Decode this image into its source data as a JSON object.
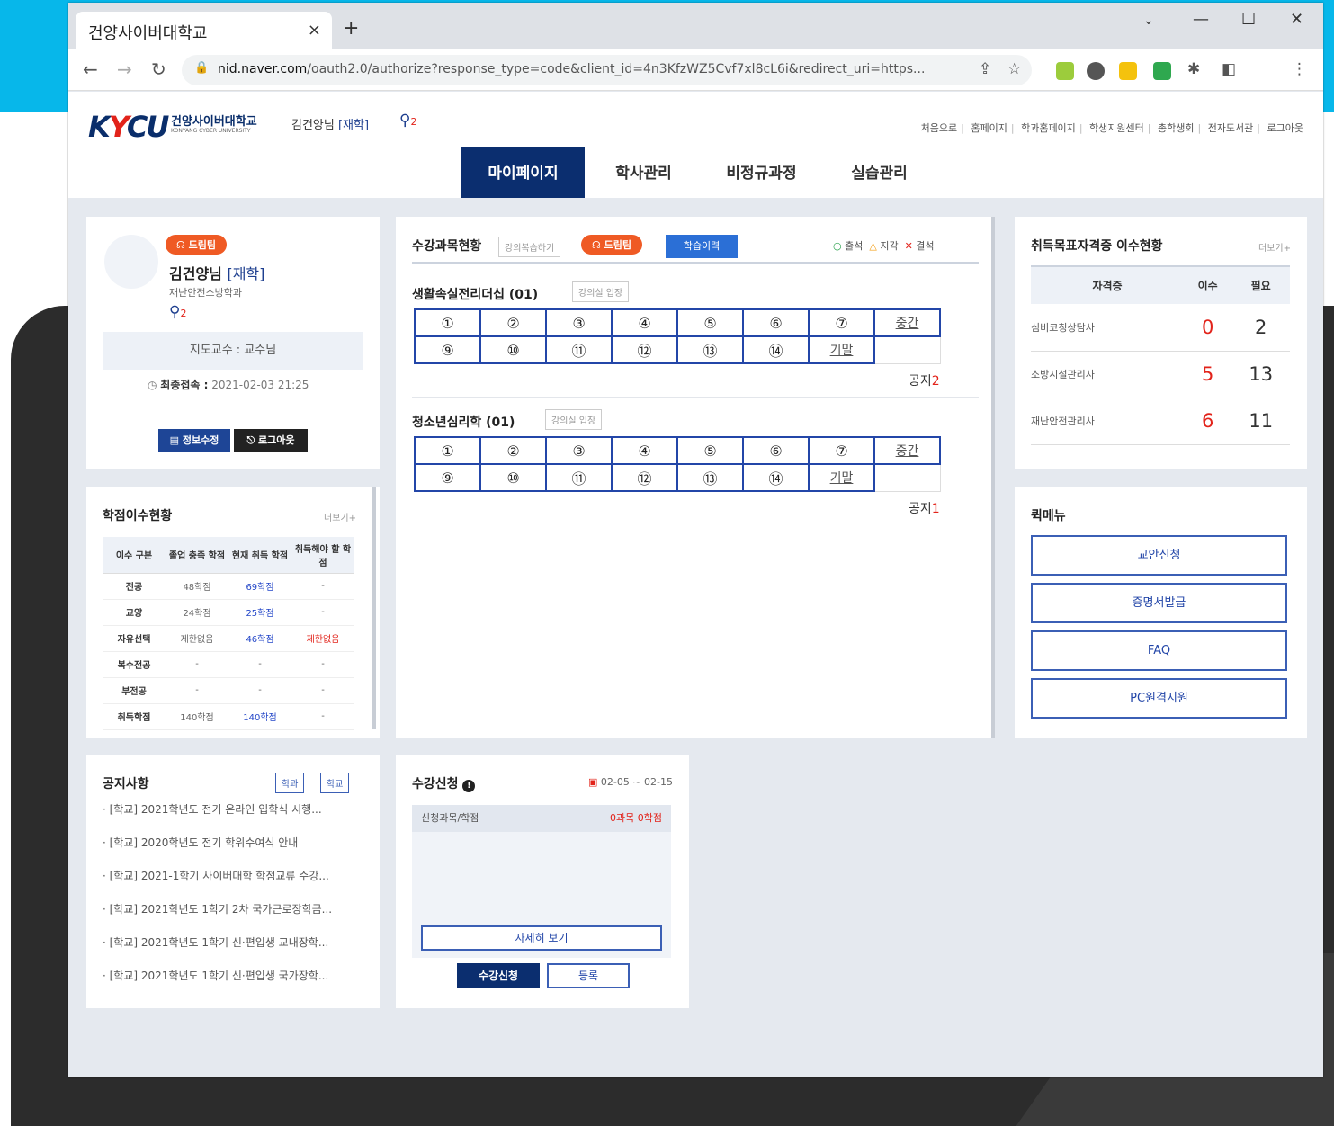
{
  "browser": {
    "tab_title": "건양사이버대학교",
    "tab_close": "×",
    "new_tab": "+",
    "url_host": "nid.naver.com",
    "url_path": "/oauth2.0/authorize?response_type=code&client_id=4n3KfzWZ5Cvf7xl8cL6i&redirect_uri=https..."
  },
  "header": {
    "logo_main": "KYCU",
    "logo_text": "건양사이버대학교",
    "logo_sub": "KONYANG CYBER UNIVERSITY",
    "user_name": "김건양님",
    "user_status": "[재학]",
    "pin_count": "2",
    "top_links": [
      "처음으로",
      "홈페이지",
      "학과홈페이지",
      "학생지원센터",
      "총학생회",
      "전자도서관",
      "로그아웃"
    ],
    "nav": [
      "마이페이지",
      "학사관리",
      "비정규과정",
      "실습관리"
    ]
  },
  "profile": {
    "badge": "드림팀",
    "name": "김건양님",
    "status": "[재학]",
    "dept": "재난안전소방학과",
    "pin_count": "2",
    "advisor": "지도교수 : 교수님",
    "last_login_label": "최종접속 :",
    "last_login": "2021-02-03 21:25",
    "btn_info": "정보수정",
    "btn_logout": "로그아웃"
  },
  "course_status": {
    "title": "수강과목현황",
    "review_btn": "강의복습하기",
    "badge": "드림팀",
    "history_btn": "학습이력",
    "legend_present": "출석",
    "legend_late": "지각",
    "legend_absent": "결석",
    "courses": [
      {
        "name": "생활속실전리더십 (01)",
        "enter": "강의실 입장",
        "row1": [
          "①",
          "②",
          "③",
          "④",
          "⑤",
          "⑥",
          "⑦",
          "중간"
        ],
        "row2": [
          "⑨",
          "⑩",
          "⑪",
          "⑫",
          "⑬",
          "⑭",
          "기말"
        ],
        "notice_label": "공지",
        "notice_count": "2"
      },
      {
        "name": "청소년심리학 (01)",
        "enter": "강의실 입장",
        "row1": [
          "①",
          "②",
          "③",
          "④",
          "⑤",
          "⑥",
          "⑦",
          "중간"
        ],
        "row2": [
          "⑨",
          "⑩",
          "⑪",
          "⑫",
          "⑬",
          "⑭",
          "기말"
        ],
        "notice_label": "공지",
        "notice_count": "1"
      }
    ]
  },
  "qualification": {
    "title": "취득목표자격증 이수현황",
    "more": "더보기+",
    "headers": [
      "자격증",
      "이수",
      "필요"
    ],
    "rows": [
      {
        "name": "심비코칭상담사",
        "done": "0",
        "need": "2"
      },
      {
        "name": "소방시설관리사",
        "done": "5",
        "need": "13"
      },
      {
        "name": "재난안전관리사",
        "done": "6",
        "need": "11"
      }
    ]
  },
  "credits": {
    "title": "학점이수현황",
    "more": "더보기+",
    "headers": [
      "이수 구분",
      "졸업 충족 학점",
      "현재 취득 학점",
      "취득해야 할 학점"
    ],
    "rows": [
      [
        "전공",
        "48학점",
        "69학점",
        "-"
      ],
      [
        "교양",
        "24학점",
        "25학점",
        "-"
      ],
      [
        "자유선택",
        "제한없음",
        "46학점",
        "제한없음"
      ],
      [
        "복수전공",
        "-",
        "-",
        "-"
      ],
      [
        "부전공",
        "-",
        "-",
        "-"
      ],
      [
        "취득학점",
        "140학점",
        "140학점",
        "-"
      ]
    ]
  },
  "quick_menu": {
    "title": "퀵메뉴",
    "items": [
      "교안신청",
      "증명서발급",
      "FAQ",
      "PC원격지원"
    ]
  },
  "notices": {
    "title": "공지사항",
    "tab_dept": "학과",
    "tab_school": "학교",
    "items": [
      "· [학교] 2021학년도 전기 온라인 입학식 시행...",
      "· [학교] 2020학년도 전기 학위수여식 안내",
      "· [학교] 2021-1학기 사이버대학 학점교류 수강...",
      "· [학교] 2021학년도 1학기 2차 국가근로장학금...",
      "· [학교] 2021학년도 1학기 신·편입생 교내장학...",
      "· [학교] 2021학년도 1학기 신·편입생 국가장학..."
    ]
  },
  "registration": {
    "title": "수강신청",
    "period": "02-05 ~ 02-15",
    "label": "신청과목/학점",
    "count": "0과목 0학점",
    "detail_btn": "자세히 보기",
    "apply_btn": "수강신청",
    "register_btn": "등록"
  },
  "colors": {
    "navy": "#0b2e6f",
    "accent_blue": "#2346a8",
    "orange": "#ef5a24",
    "red": "#e2231a",
    "cyan_bg": "#07b7ea"
  }
}
